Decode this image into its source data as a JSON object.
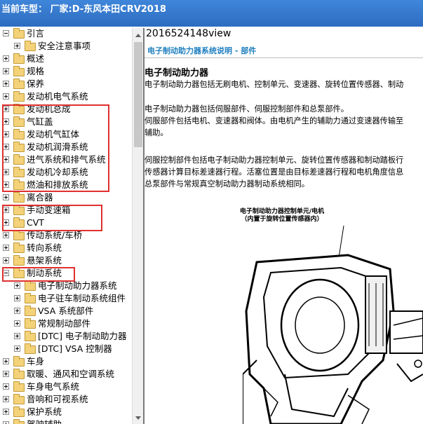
{
  "window": {
    "title": "当前车型：  厂家:D-东风本田CRV2018"
  },
  "tree": {
    "items": [
      {
        "label": "引言",
        "level": 0,
        "expanded": true
      },
      {
        "label": "安全注意事项",
        "level": 1,
        "expanded": false
      },
      {
        "label": "概述",
        "level": 0,
        "expanded": false
      },
      {
        "label": "规格",
        "level": 0,
        "expanded": false
      },
      {
        "label": "保养",
        "level": 0,
        "expanded": false
      },
      {
        "label": "发动机电气系统",
        "level": 0,
        "expanded": false
      },
      {
        "label": "发动机总成",
        "level": 0,
        "expanded": false
      },
      {
        "label": "气缸盖",
        "level": 0,
        "expanded": false
      },
      {
        "label": "发动机气缸体",
        "level": 0,
        "expanded": false
      },
      {
        "label": "发动机润滑系统",
        "level": 0,
        "expanded": false
      },
      {
        "label": "进气系统和排气系统",
        "level": 0,
        "expanded": false
      },
      {
        "label": "发动机冷却系统",
        "level": 0,
        "expanded": false
      },
      {
        "label": "燃油和排放系统",
        "level": 0,
        "expanded": false
      },
      {
        "label": "离合器",
        "level": 0,
        "expanded": false
      },
      {
        "label": "手动变速箱",
        "level": 0,
        "expanded": false
      },
      {
        "label": "CVT",
        "level": 0,
        "expanded": false
      },
      {
        "label": "传动系统/车桥",
        "level": 0,
        "expanded": false
      },
      {
        "label": "转向系统",
        "level": 0,
        "expanded": false
      },
      {
        "label": "悬架系统",
        "level": 0,
        "expanded": false
      },
      {
        "label": "制动系统",
        "level": 0,
        "expanded": true
      },
      {
        "label": "电子制动助力器系统",
        "level": 1,
        "expanded": false
      },
      {
        "label": "电子驻车制动系统组件",
        "level": 1,
        "expanded": false
      },
      {
        "label": "VSA 系统部件",
        "level": 1,
        "expanded": false
      },
      {
        "label": "常规制动部件",
        "level": 1,
        "expanded": false
      },
      {
        "label": "[DTC] 电子制动助力器",
        "level": 1,
        "expanded": false
      },
      {
        "label": "[DTC] VSA 控制器",
        "level": 1,
        "expanded": false
      },
      {
        "label": "车身",
        "level": 0,
        "expanded": false
      },
      {
        "label": "取暖、通风和空调系统",
        "level": 0,
        "expanded": false
      },
      {
        "label": "车身电气系统",
        "level": 0,
        "expanded": false
      },
      {
        "label": "音响和可视系统",
        "level": 0,
        "expanded": false
      },
      {
        "label": "保护系统",
        "level": 0,
        "expanded": false
      },
      {
        "label": "驾驶辅助",
        "level": 0,
        "expanded": false
      }
    ]
  },
  "content": {
    "doc_title": "2016524148view",
    "subtitle": "电子制动助力器系统说明 - 部件",
    "section_title": "电子制动助力器",
    "paragraphs": [
      "电子制动助力器包括无刷电机、控制单元、变速器、旋转位置传感器、制动",
      "电子制动助力器包括伺服部件、伺服控制部件和总泵部件。",
      "伺服部件包括电机、变速器和阀体。由电机产生的辅助力通过变速器传输至",
      "辅助。",
      "伺服控制部件包括电子制动助力器控制单元、旋转位置传感器和制动踏板行",
      "传感器计算目标差速器行程。活塞位置是由目标差速器行程和电机角度信息",
      "总泵部件与常规真空制动助力器制动系统相同。"
    ],
    "figure_caption_line1": "电子制动助力器控制单元/电机",
    "figure_caption_line2": "（内置于旋转位置传感器内）"
  },
  "colors": {
    "titlebar": "#2d6cc0",
    "highlight": "#e03030",
    "subtitle": "#1f7fbf",
    "folder": "#f4d27a"
  }
}
